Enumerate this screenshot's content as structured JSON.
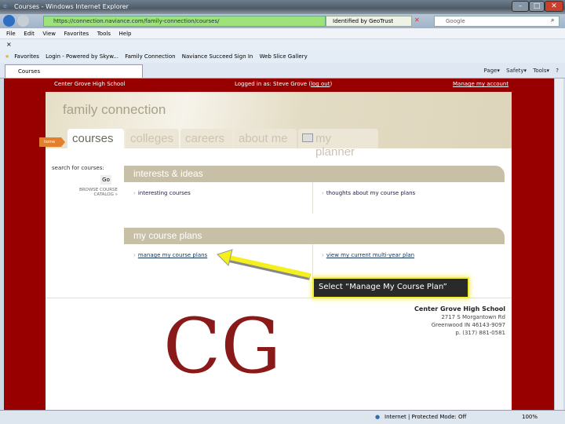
{
  "window": {
    "title": "Courses - Windows Internet Explorer"
  },
  "address": {
    "url": "https://connection.naviance.com/family-connection/courses/",
    "security": "Identified by GeoTrust",
    "search_placeholder": "Google"
  },
  "menu": [
    "File",
    "Edit",
    "View",
    "Favorites",
    "Tools",
    "Help"
  ],
  "favorites": {
    "label": "Favorites",
    "items": [
      "Login - Powered by Skyw...",
      "Family Connection",
      "Naviance Succeed Sign In",
      "Web Slice Gallery"
    ]
  },
  "tab": {
    "label": "Courses"
  },
  "command_bar": [
    "Page",
    "Safety",
    "Tools"
  ],
  "site": {
    "school": "Center Grove High School",
    "logged_in": "Logged in as: Steve Grove",
    "log_out": "log out",
    "manage_account": "Manage my account"
  },
  "header": {
    "title": "family connection",
    "home": "home",
    "tabs": [
      "courses",
      "colleges",
      "careers",
      "about me",
      "my planner"
    ]
  },
  "sidebar": {
    "search_label": "search for courses:",
    "go": "Go",
    "browse": "BROWSE COURSE CATALOG »"
  },
  "panels": [
    {
      "title": "interests & ideas",
      "links": [
        "interesting courses",
        "thoughts about my course plans"
      ]
    },
    {
      "title": "my course plans",
      "links": [
        "manage my course plans",
        "view my current multi-year plan"
      ]
    }
  ],
  "callout": "Select “Manage My Course Plan”",
  "footer": {
    "logo": "CG",
    "school": "Center Grove High School",
    "address1": "2717 S Morgantown Rd",
    "address2": "Greenwood IN 46143-9097",
    "phone": "p. (317) 881-0581"
  },
  "status": {
    "zone": "Internet | Protected Mode: Off",
    "zoom": "100%"
  },
  "colors": {
    "brand": "#980000",
    "accent": "#e2802e",
    "highlight": "#f2ee30"
  }
}
